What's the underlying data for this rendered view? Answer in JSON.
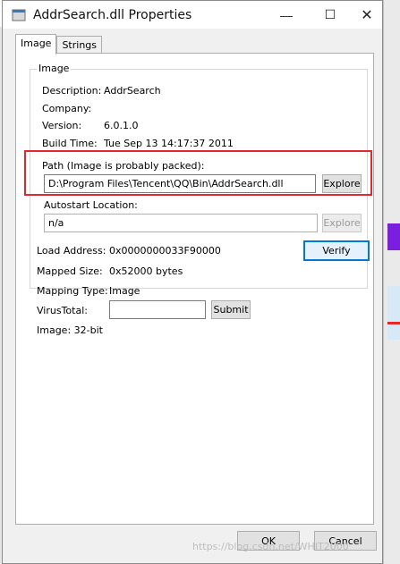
{
  "window": {
    "title": "AddrSearch.dll Properties",
    "buttons": {
      "minimize": "—",
      "maximize": "☐",
      "close": "✕"
    }
  },
  "tabs": [
    {
      "label": "Image",
      "active": true
    },
    {
      "label": "Strings",
      "active": false
    }
  ],
  "image_group": {
    "legend": "Image",
    "description_label": "Description:",
    "description_value": "AddrSearch",
    "company_label": "Company:",
    "company_value": "",
    "version_label": "Version:",
    "version_value": "6.0.1.0",
    "build_label": "Build Time:",
    "build_value": "Tue Sep 13 14:17:37 2011",
    "path_label": "Path (Image is probably packed):",
    "path_value": "D:\\Program Files\\Tencent\\QQ\\Bin\\AddrSearch.dll",
    "explore_label": "Explore",
    "autostart_label": "Autostart Location:",
    "autostart_value": "n/a",
    "explore2_label": "Explore"
  },
  "info": {
    "load_address_label": "Load Address:",
    "load_address_value": "0x0000000033F90000",
    "verify_label": "Verify",
    "mapped_size_label": "Mapped Size:",
    "mapped_size_value": "0x52000 bytes",
    "mapping_type_label": "Mapping Type:",
    "mapping_type_value": "Image",
    "virustotal_label": "VirusTotal:",
    "virustotal_value": "",
    "submit_label": "Submit",
    "image_bits": "Image: 32-bit"
  },
  "footer": {
    "ok_label": "OK",
    "cancel_label": "Cancel",
    "watermark": "https://blog.csdn.net/WHIT2000"
  },
  "colors": {
    "highlight": "#e0282e",
    "default_button_border": "#0078d7"
  }
}
